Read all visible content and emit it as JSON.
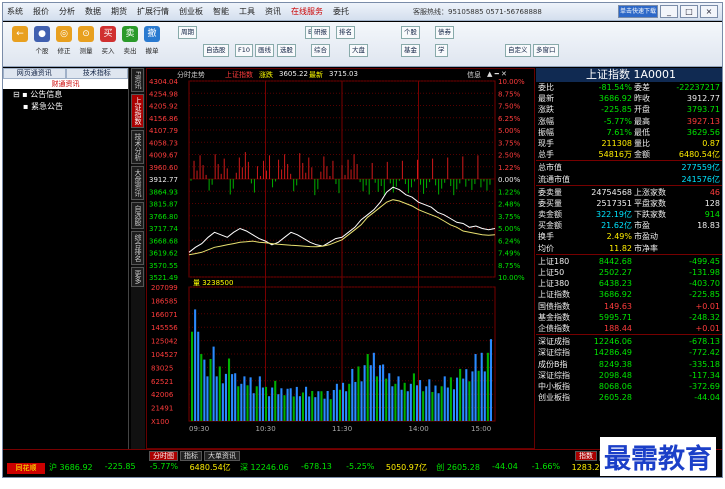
{
  "menu": [
    "系统",
    "报价",
    "分析",
    "数据",
    "期货",
    "扩展行情",
    "创业板",
    "智能",
    "工具",
    "资讯",
    "在线服务",
    "委托"
  ],
  "hotline": "客服热线：95105885  0571-56768888",
  "window_buttons": [
    "单击快速下载",
    "_",
    "□",
    "×"
  ],
  "toolbar": {
    "buttons": [
      {
        "label": "",
        "icon": "back-arrow-icon",
        "color": "#e8a020"
      },
      {
        "label": "个股",
        "icon": "stock-icon",
        "color": "#4060b0"
      },
      {
        "label": "修正",
        "icon": "correct-icon",
        "color": "#e8a020"
      },
      {
        "label": "测量",
        "icon": "measure-icon",
        "color": "#e8a020"
      },
      {
        "label": "买入",
        "icon": "buy-icon",
        "color": "#d03030"
      },
      {
        "label": "卖出",
        "icon": "sell-icon",
        "color": "#2a9a2a"
      },
      {
        "label": "撤单",
        "icon": "cancel-icon",
        "color": "#2a7ad0"
      }
    ],
    "small": [
      "周期",
      "自选股",
      "F10",
      "画线",
      "选股",
      "BBD",
      "综合",
      "研报",
      "排名",
      "大盘",
      "个股",
      "基金",
      "债券",
      "学",
      "自定义",
      "多窗口"
    ]
  },
  "left_panel": {
    "tabs": [
      "网页通资讯",
      "技术指标"
    ],
    "subtitle": "财通资讯",
    "tree": [
      "公告信息",
      "紧急公告"
    ]
  },
  "vertical_tabs": [
    "F资讯",
    "上证指数",
    "技术分析",
    "大盘资讯",
    "自选股",
    "综合排名",
    "更多"
  ],
  "chart_header": {
    "title": "分时走势",
    "index_name": "上证指数",
    "change_label": "涨跌",
    "price1": "3605.22",
    "price2_label": "最新",
    "price2": "3715.03",
    "info": "信息"
  },
  "volume_label": "量",
  "volume_value": "3238500",
  "chart_data": {
    "type": "line",
    "title": "分时走势",
    "price_axis": [
      4304.04,
      4254.98,
      4205.92,
      4156.86,
      4107.79,
      4058.73,
      4009.67,
      3960.6,
      3912.77,
      3864.93,
      3815.87,
      3766.8,
      3717.74,
      3668.68,
      3619.62,
      3570.55,
      3521.49
    ],
    "pct_axis": [
      "10.00%",
      "8.75%",
      "7.50%",
      "6.25%",
      "5.00%",
      "3.75%",
      "2.50%",
      "1.22%",
      "0.00%",
      "1.22%",
      "2.48%",
      "3.75%",
      "5.00%",
      "6.24%",
      "7.49%",
      "8.75%",
      "10.00%"
    ],
    "volume_axis": [
      207099,
      186585,
      166071,
      145556,
      125042,
      104527,
      83025,
      62521,
      42006,
      21491,
      "X100"
    ],
    "time_axis": [
      "09:30",
      "10:30",
      "11:30",
      "14:00",
      "15:00"
    ],
    "price_line": [
      3620,
      3640,
      3655,
      3680,
      3700,
      3690,
      3680,
      3700,
      3715,
      3705,
      3690,
      3675,
      3665,
      3650,
      3660,
      3680,
      3700,
      3690,
      3675,
      3660,
      3650,
      3645,
      3660,
      3675,
      3680,
      3700,
      3720,
      3750,
      3770,
      3790,
      3820,
      3860,
      3880,
      3870,
      3850,
      3840,
      3820,
      3810,
      3800,
      3780,
      3770,
      3755,
      3740,
      3735,
      3720,
      3725,
      3715,
      3710,
      3715
    ],
    "avg_line": [
      3610,
      3615,
      3620,
      3630,
      3640,
      3645,
      3650,
      3655,
      3660,
      3662,
      3665,
      3660,
      3658,
      3655,
      3652,
      3650,
      3648,
      3647,
      3645,
      3643,
      3642,
      3645,
      3650,
      3660,
      3670,
      3690,
      3710,
      3730,
      3760,
      3780,
      3800,
      3820,
      3830,
      3825,
      3815,
      3805,
      3790,
      3780,
      3770,
      3760,
      3745,
      3730,
      3720,
      3705,
      3700,
      3695,
      3690,
      3688,
      3690
    ],
    "volume": [
      90,
      60,
      45,
      50,
      40,
      38,
      42,
      35,
      30,
      32,
      28,
      30,
      25,
      27,
      24,
      26,
      22,
      25,
      23,
      22,
      24,
      20,
      22,
      25,
      28,
      30,
      35,
      40,
      45,
      50,
      45,
      38,
      35,
      30,
      28,
      30,
      32,
      30,
      28,
      26,
      28,
      30,
      32,
      35,
      38,
      40,
      45,
      50,
      55
    ]
  },
  "right_panel": {
    "title": "上证指数 1A0001",
    "rows": [
      {
        "l": "委比",
        "v": "-81.54%",
        "vc": "grn",
        "l2": "委差",
        "v2": "-22237217",
        "v2c": "grn"
      },
      {
        "l": "最新",
        "v": "3686.92",
        "vc": "grn",
        "l2": "昨收",
        "v2": "3912.77",
        "v2c": "wht"
      },
      {
        "l": "涨跌",
        "v": "-225.85",
        "vc": "grn",
        "l2": "开盘",
        "v2": "3793.71",
        "v2c": "grn"
      },
      {
        "l": "涨幅",
        "v": "-5.77%",
        "vc": "grn",
        "l2": "最高",
        "v2": "3927.13",
        "v2c": "red"
      },
      {
        "l": "振幅",
        "v": "7.61%",
        "vc": "grn",
        "l2": "最低",
        "v2": "3629.56",
        "v2c": "grn"
      },
      {
        "l": "现手",
        "v": "211308",
        "vc": "yel",
        "l2": "量比",
        "v2": "0.87",
        "v2c": "yel"
      },
      {
        "l": "总手",
        "v": "54816万",
        "vc": "yel",
        "l2": "金额",
        "v2": "6480.54亿",
        "v2c": "yel"
      },
      {
        "sep": true
      },
      {
        "l": "总市值",
        "v": "",
        "vc": "wht",
        "l2": "",
        "v2": "277559亿",
        "v2c": "cyn"
      },
      {
        "l": "流通市值",
        "v": "",
        "vc": "wht",
        "l2": "",
        "v2": "241576亿",
        "v2c": "cyn"
      },
      {
        "sep": true
      },
      {
        "l": "委卖量",
        "v": "24754568",
        "vc": "wht",
        "l2": "上涨家数",
        "v2": "46",
        "v2c": "red"
      },
      {
        "l": "委买量",
        "v": "2517351",
        "vc": "wht",
        "l2": "平盘家数",
        "v2": "128",
        "v2c": "wht"
      },
      {
        "l": "卖金额",
        "v": "322.19亿",
        "vc": "cyn",
        "l2": "下跌家数",
        "v2": "914",
        "v2c": "grn"
      },
      {
        "l": "买金额",
        "v": "21.62亿",
        "vc": "cyn",
        "l2": "市盈",
        "v2": "18.83",
        "v2c": "wht"
      },
      {
        "l": "换手",
        "v": "2.49%",
        "vc": "yel",
        "l2": "市盈动",
        "v2": "",
        "v2c": "wht"
      },
      {
        "l": "均价",
        "v": "11.82",
        "vc": "yel",
        "l2": "市净率",
        "v2": "",
        "v2c": "wht"
      },
      {
        "sep": true
      },
      {
        "l": "上证180",
        "v": "8442.68",
        "vc": "grn",
        "l2": "",
        "v2": "-499.45",
        "v2c": "grn"
      },
      {
        "l": "上证50",
        "v": "2502.27",
        "vc": "grn",
        "l2": "",
        "v2": "-131.98",
        "v2c": "grn"
      },
      {
        "l": "上证380",
        "v": "6438.23",
        "vc": "grn",
        "l2": "",
        "v2": "-403.70",
        "v2c": "grn"
      },
      {
        "l": "上证指数",
        "v": "3686.92",
        "vc": "grn",
        "l2": "",
        "v2": "-225.85",
        "v2c": "grn"
      },
      {
        "l": "国债指数",
        "v": "149.63",
        "vc": "red",
        "l2": "",
        "v2": "+0.01",
        "v2c": "red"
      },
      {
        "l": "基金指数",
        "v": "5995.71",
        "vc": "grn",
        "l2": "",
        "v2": "-248.32",
        "v2c": "grn"
      },
      {
        "l": "企债指数",
        "v": "188.44",
        "vc": "red",
        "l2": "",
        "v2": "+0.01",
        "v2c": "red"
      },
      {
        "sep": true
      },
      {
        "l": "深证成指",
        "v": "12246.06",
        "vc": "grn",
        "l2": "",
        "v2": "-678.13",
        "v2c": "grn"
      },
      {
        "l": "深证综指",
        "v": "14286.49",
        "vc": "grn",
        "l2": "",
        "v2": "-772.42",
        "v2c": "grn"
      },
      {
        "l": "成份B指",
        "v": "8249.38",
        "vc": "grn",
        "l2": "",
        "v2": "-335.18",
        "v2c": "grn"
      },
      {
        "l": "深证综指",
        "v": "2098.48",
        "vc": "grn",
        "l2": "",
        "v2": "-117.34",
        "v2c": "grn"
      },
      {
        "l": "中小板指",
        "v": "8068.06",
        "vc": "grn",
        "l2": "",
        "v2": "-372.69",
        "v2c": "grn"
      },
      {
        "l": "创业板指",
        "v": "2605.28",
        "vc": "grn",
        "l2": "",
        "v2": "-44.04",
        "v2c": "grn"
      }
    ]
  },
  "status_tabs": [
    "分时图",
    "指标",
    "大单资讯"
  ],
  "right_tabs": [
    "指数",
    "个股"
  ],
  "ticker": {
    "logo": "同花顺",
    "items": [
      {
        "t": "沪 3686.92",
        "c": "grn"
      },
      {
        "t": "-225.85",
        "c": "grn"
      },
      {
        "t": "-5.77%",
        "c": "grn"
      },
      {
        "t": "6480.54亿",
        "c": "yel"
      },
      {
        "t": "深 12246.06",
        "c": "grn"
      },
      {
        "t": "-678.13",
        "c": "grn"
      },
      {
        "t": "-5.25%",
        "c": "grn"
      },
      {
        "t": "5050.97亿",
        "c": "yel"
      },
      {
        "t": "创 2605.28",
        "c": "grn"
      },
      {
        "t": "-44.04",
        "c": "grn"
      },
      {
        "t": "-1.66%",
        "c": "grn"
      },
      {
        "t": "1283.26亿",
        "c": "yel"
      },
      {
        "t": "沪深300",
        "c": "wht"
      },
      {
        "t": "\"F1\"查看我的",
        "c": "yel"
      }
    ]
  },
  "watermark": "最需教育"
}
